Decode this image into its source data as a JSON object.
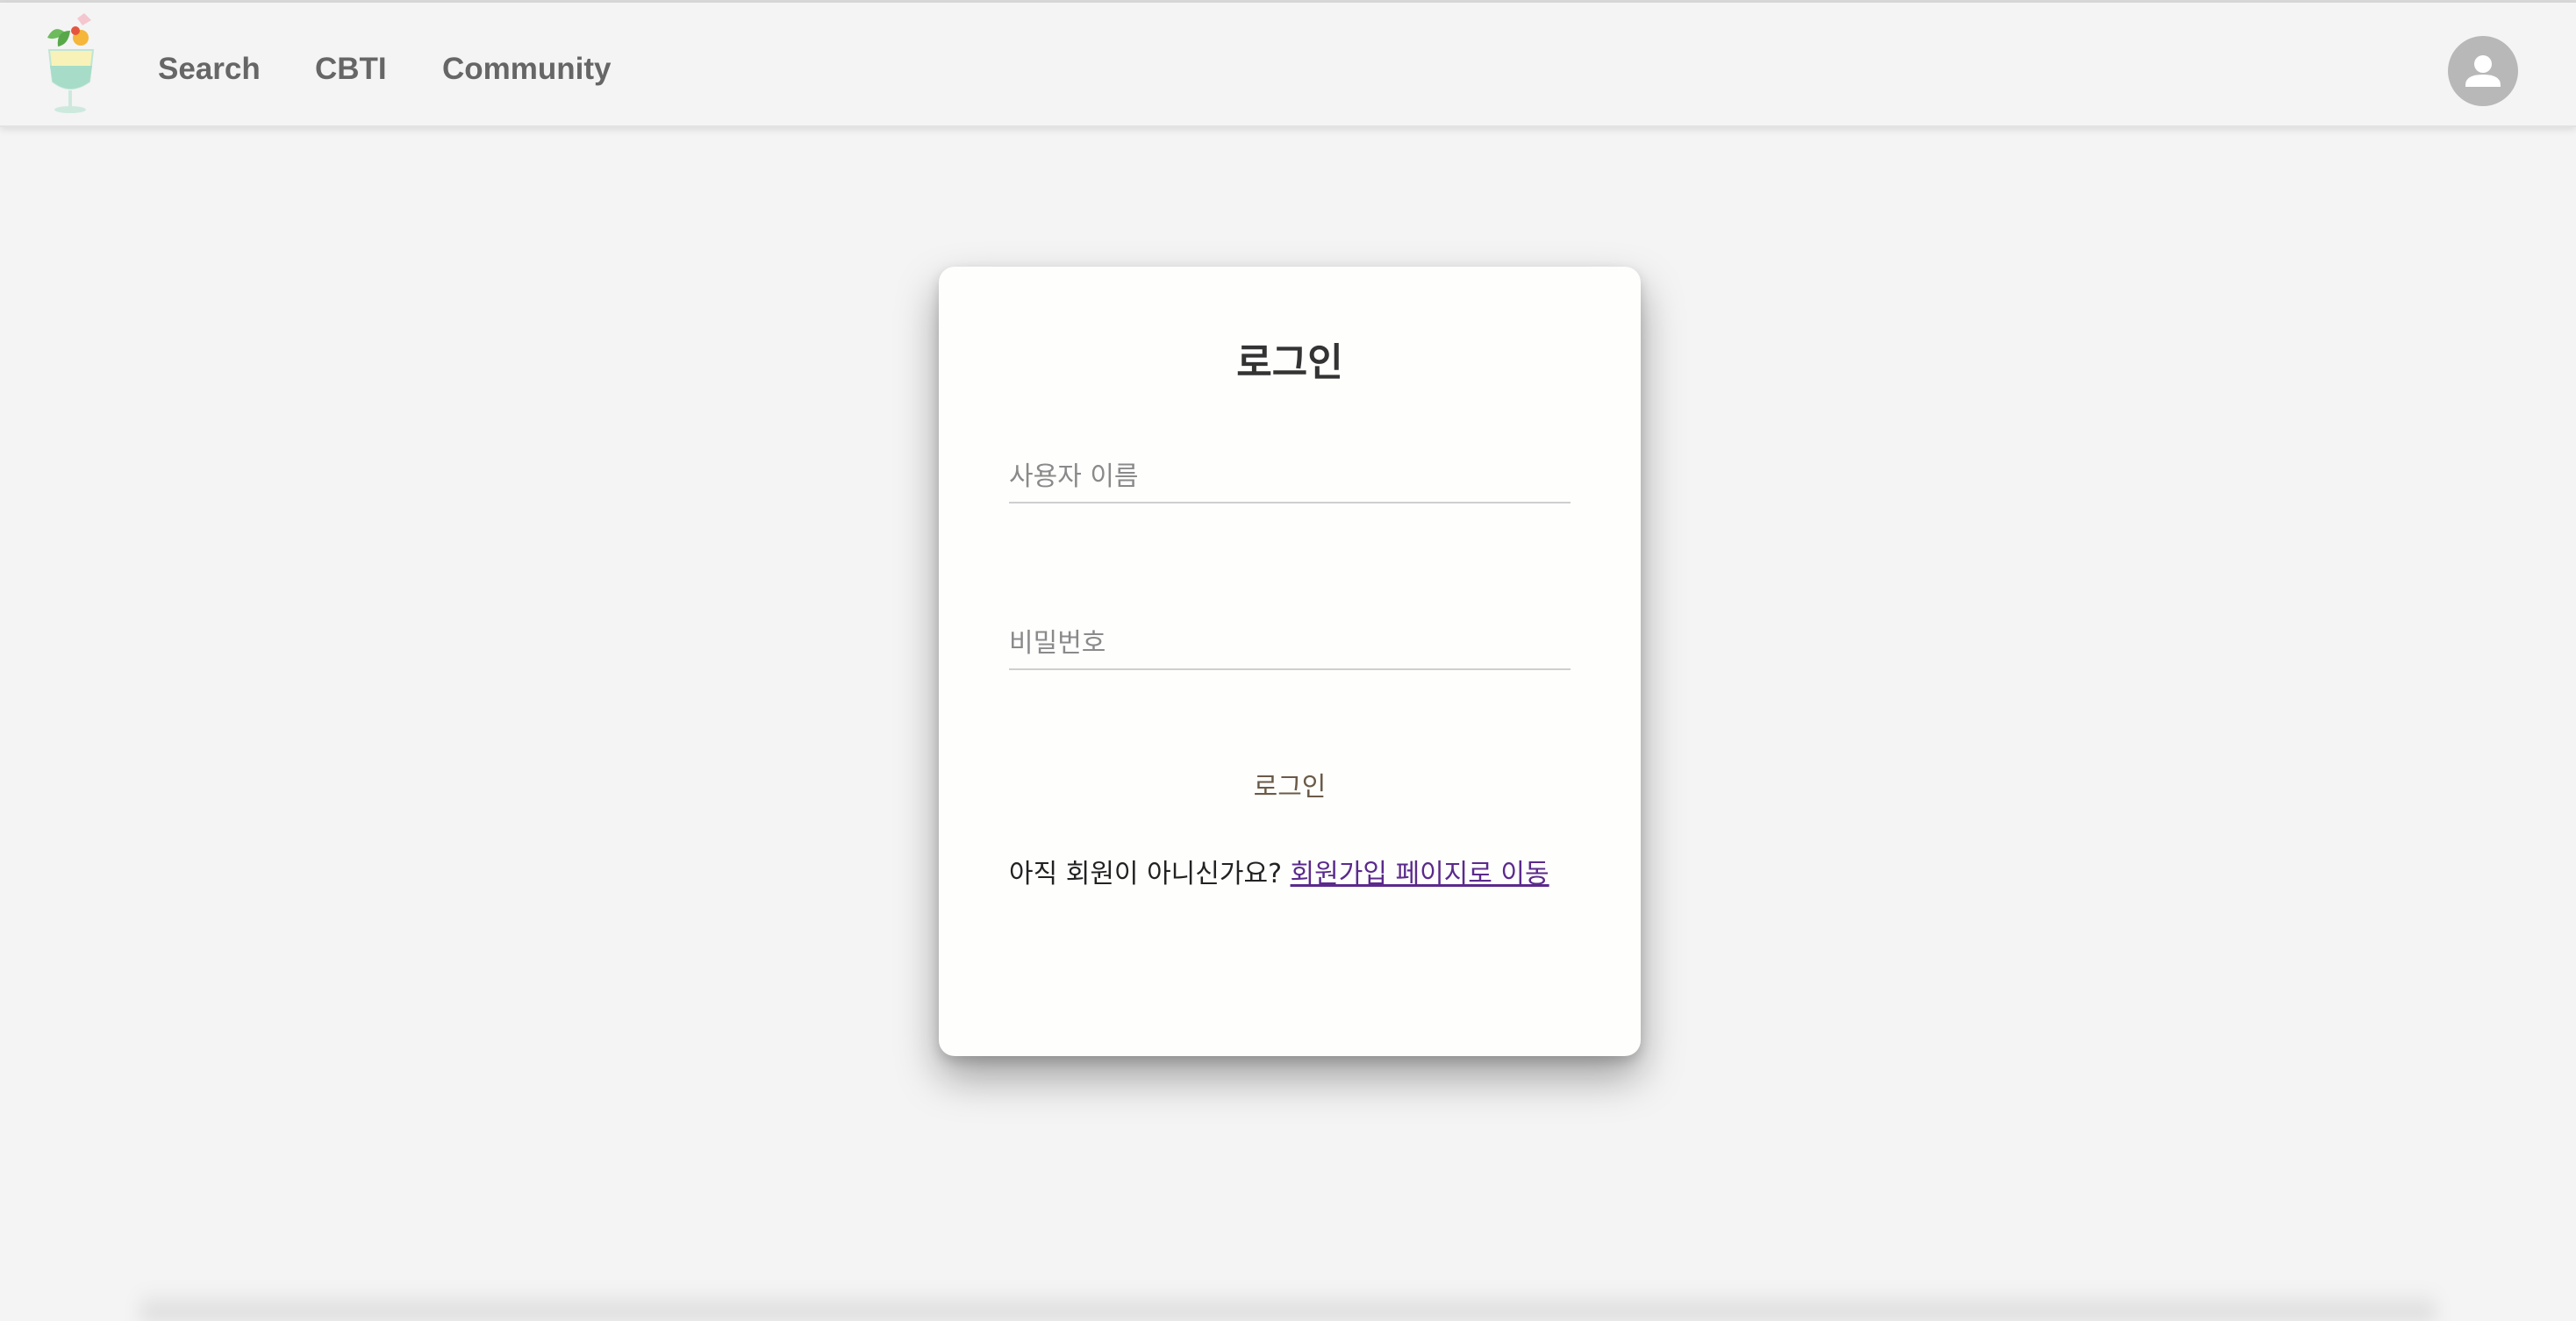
{
  "nav": {
    "links": [
      "Search",
      "CBTI",
      "Community"
    ]
  },
  "login": {
    "title": "로그인",
    "username_placeholder": "사용자 이름",
    "password_placeholder": "비밀번호",
    "submit_label": "로그인",
    "signup_prompt": "아직 회원이 아니신가요?",
    "signup_link": "회원가입 페이지로 이동"
  },
  "colors": {
    "background": "#f4f4f4",
    "card": "#fefefd",
    "nav_text": "#666666",
    "link": "#5b2a8c",
    "avatar": "#b8b8b8"
  },
  "icons": {
    "logo": "cocktail-glass-logo",
    "avatar": "user-icon"
  }
}
